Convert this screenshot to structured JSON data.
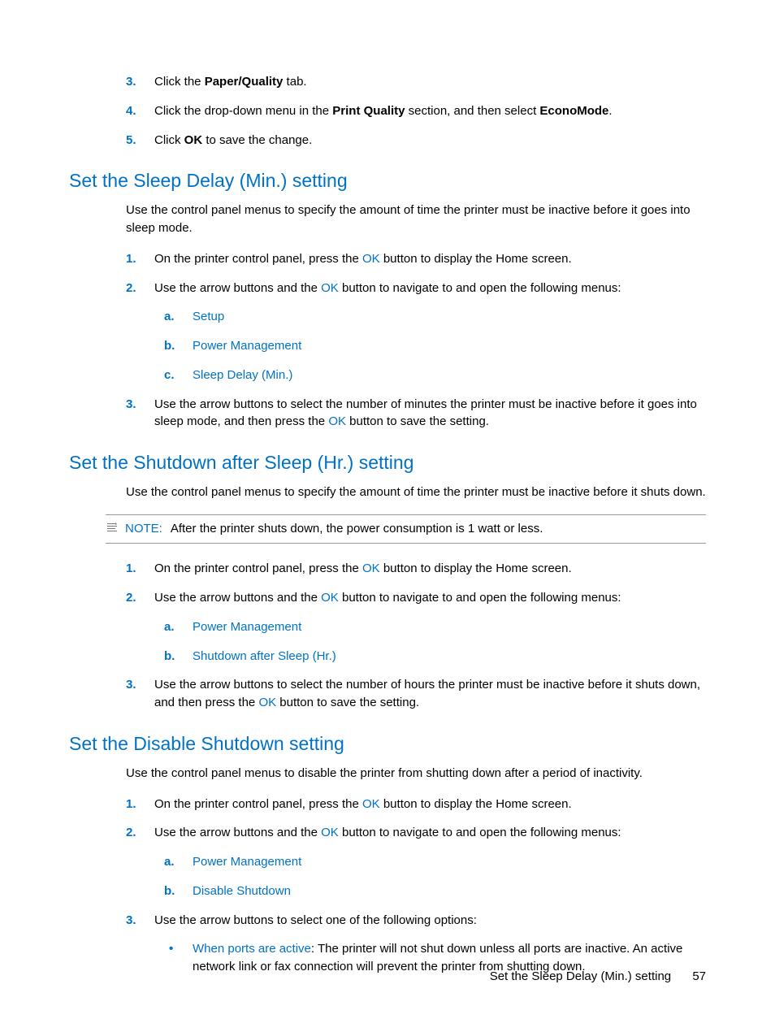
{
  "topList": {
    "item3": {
      "num": "3.",
      "pre": "Click the ",
      "bold": "Paper/Quality",
      "post": " tab."
    },
    "item4": {
      "num": "4.",
      "pre": "Click the drop-down menu in the ",
      "bold1": "Print Quality",
      "mid": " section, and then select ",
      "bold2": "EconoMode",
      "post": "."
    },
    "item5": {
      "num": "5.",
      "pre": "Click ",
      "bold": "OK",
      "post": " to save the change."
    }
  },
  "section1": {
    "heading": "Set the Sleep Delay (Min.) setting",
    "intro": "Use the control panel menus to specify the amount of time the printer must be inactive before it goes into sleep mode.",
    "step1": {
      "num": "1.",
      "pre": "On the printer control panel, press the ",
      "ok": "OK",
      "post": " button to display the Home screen."
    },
    "step2": {
      "num": "2.",
      "pre": "Use the arrow buttons and the ",
      "ok": "OK",
      "post": " button to navigate to and open the following menus:",
      "a": {
        "letter": "a.",
        "text": "Setup"
      },
      "b": {
        "letter": "b.",
        "text": "Power Management"
      },
      "c": {
        "letter": "c.",
        "text": "Sleep Delay (Min.)"
      }
    },
    "step3": {
      "num": "3.",
      "pre": "Use the arrow buttons to select the number of minutes the printer must be inactive before it goes into sleep mode, and then press the ",
      "ok": "OK",
      "post": " button to save the setting."
    }
  },
  "section2": {
    "heading": "Set the Shutdown after Sleep (Hr.) setting",
    "intro": "Use the control panel menus to specify the amount of time the printer must be inactive before it shuts down.",
    "noteLabel": "NOTE:",
    "noteText": "After the printer shuts down, the power consumption is 1 watt or less.",
    "step1": {
      "num": "1.",
      "pre": "On the printer control panel, press the ",
      "ok": "OK",
      "post": " button to display the Home screen."
    },
    "step2": {
      "num": "2.",
      "pre": "Use the arrow buttons and the ",
      "ok": "OK",
      "post": " button to navigate to and open the following menus:",
      "a": {
        "letter": "a.",
        "text": "Power Management"
      },
      "b": {
        "letter": "b.",
        "text": "Shutdown after Sleep (Hr.)"
      }
    },
    "step3": {
      "num": "3.",
      "pre": "Use the arrow buttons to select the number of hours the printer must be inactive before it shuts down, and then press the ",
      "ok": "OK",
      "post": " button to save the setting."
    }
  },
  "section3": {
    "heading": "Set the Disable Shutdown setting",
    "intro": "Use the control panel menus to disable the printer from shutting down after a period of inactivity.",
    "step1": {
      "num": "1.",
      "pre": "On the printer control panel, press the ",
      "ok": "OK",
      "post": " button to display the Home screen."
    },
    "step2": {
      "num": "2.",
      "pre": "Use the arrow buttons and the ",
      "ok": "OK",
      "post": " button to navigate to and open the following menus:",
      "a": {
        "letter": "a.",
        "text": "Power Management"
      },
      "b": {
        "letter": "b.",
        "text": "Disable Shutdown"
      }
    },
    "step3": {
      "num": "3.",
      "text": "Use the arrow buttons to select one of the following options:",
      "bullet1": {
        "bold": "When ports are active",
        "rest": ": The printer will not shut down unless all ports are inactive. An active network link or fax connection will prevent the printer from shutting down."
      }
    }
  },
  "footer": {
    "title": "Set the Sleep Delay (Min.) setting",
    "page": "57"
  }
}
